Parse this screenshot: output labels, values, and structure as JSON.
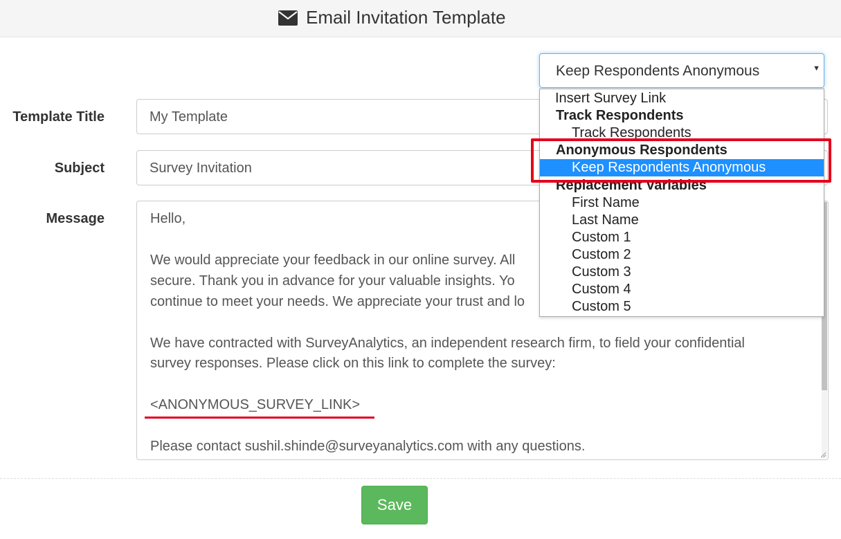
{
  "header": {
    "icon": "envelope-icon",
    "title": "Email Invitation Template"
  },
  "placeholder_select": {
    "selected": "Keep Respondents Anonymous",
    "caret_icon": "caret-down-icon",
    "options": [
      {
        "label": "Insert Survey Link",
        "kind": "option"
      },
      {
        "label": "Track Respondents",
        "kind": "group"
      },
      {
        "label": "Track Respondents",
        "kind": "child"
      },
      {
        "label": "Anonymous Respondents",
        "kind": "group"
      },
      {
        "label": "Keep Respondents Anonymous",
        "kind": "child",
        "selected": true
      },
      {
        "label": "Replacement Variables",
        "kind": "group"
      },
      {
        "label": "First Name",
        "kind": "child"
      },
      {
        "label": "Last Name",
        "kind": "child"
      },
      {
        "label": "Custom 1",
        "kind": "child"
      },
      {
        "label": "Custom 2",
        "kind": "child"
      },
      {
        "label": "Custom 3",
        "kind": "child"
      },
      {
        "label": "Custom 4",
        "kind": "child"
      },
      {
        "label": "Custom 5",
        "kind": "child"
      }
    ]
  },
  "form": {
    "title_label": "Template Title",
    "title_value": "My Template",
    "subject_label": "Subject",
    "subject_value": "Survey Invitation",
    "message_label": "Message",
    "message_lines": [
      "Hello,",
      "",
      "We would appreciate your feedback in our online survey.  All",
      "secure.  Thank you in advance for your valuable insights.  Yo",
      "continue to meet your needs. We appreciate your trust and lo",
      "",
      "We have contracted with SurveyAnalytics, an independent research firm, to field your confidential",
      "survey responses.  Please click on this link to complete the survey:",
      "",
      "<ANONYMOUS_SURVEY_LINK>",
      "",
      "Please contact sushil.shinde@surveyanalytics.com with any questions."
    ]
  },
  "actions": {
    "save_label": "Save"
  },
  "colors": {
    "accent_focus": "#66afe9",
    "save_button": "#5cb85c",
    "selected_option": "#1e90ff",
    "annotation_red": "#e3001b"
  }
}
